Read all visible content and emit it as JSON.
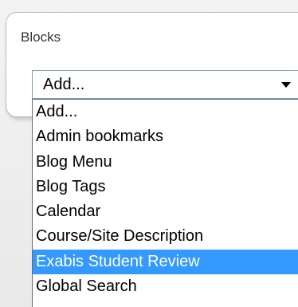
{
  "block": {
    "title": "Blocks"
  },
  "select": {
    "current_value": "Add...",
    "options": [
      "Add...",
      "Admin bookmarks",
      "Blog Menu",
      "Blog Tags",
      "Calendar",
      "Course/Site Description",
      "Exabis Student Review",
      "Global Search"
    ],
    "highlighted": "Exabis Student Review"
  },
  "colors": {
    "highlight": "#3399ff",
    "border": "#7f9db9"
  }
}
